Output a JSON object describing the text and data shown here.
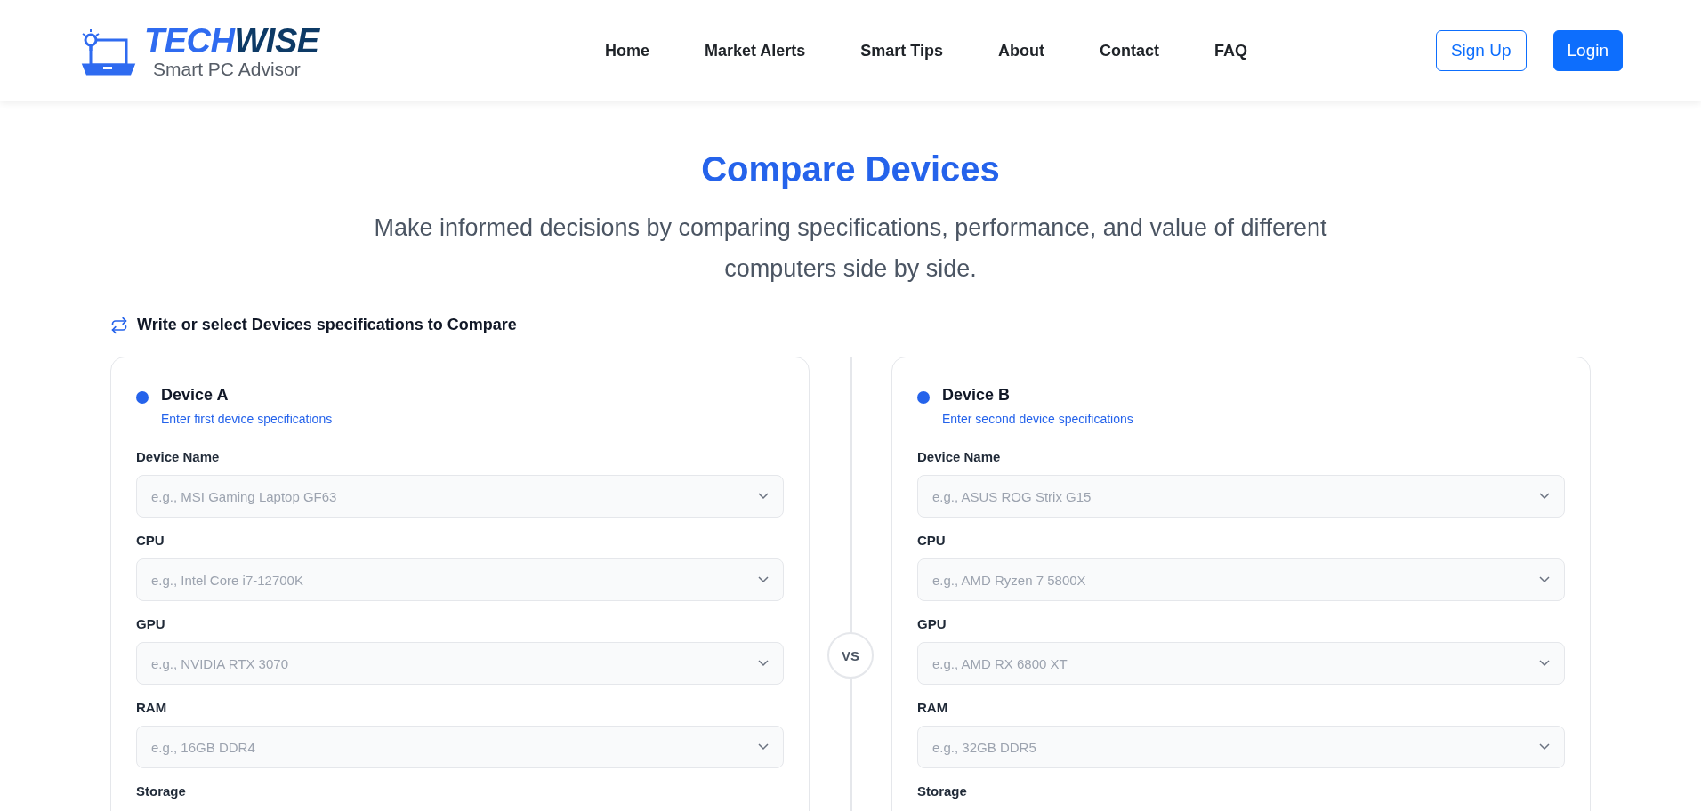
{
  "brand": {
    "name_part_1": "TECH",
    "name_part_2": "WISE",
    "tagline": "Smart PC Advisor"
  },
  "nav": [
    {
      "label": "Home"
    },
    {
      "label": "Market Alerts"
    },
    {
      "label": "Smart Tips"
    },
    {
      "label": "About"
    },
    {
      "label": "Contact"
    },
    {
      "label": "FAQ"
    }
  ],
  "auth": {
    "sign_up": "Sign Up",
    "login": "Login"
  },
  "page": {
    "title": "Compare Devices",
    "subtitle": "Make informed decisions by comparing specifications, performance, and value of different computers side by side."
  },
  "section_label": "Write or select Devices specifications to Compare",
  "divider_label": "VS",
  "devices": [
    {
      "title": "Device A",
      "subtitle": "Enter first device specifications",
      "fields": [
        {
          "label": "Device Name",
          "placeholder": "e.g., MSI Gaming Laptop GF63"
        },
        {
          "label": "CPU",
          "placeholder": "e.g., Intel Core i7-12700K"
        },
        {
          "label": "GPU",
          "placeholder": "e.g., NVIDIA RTX 3070"
        },
        {
          "label": "RAM",
          "placeholder": "e.g., 16GB DDR4"
        },
        {
          "label": "Storage"
        }
      ]
    },
    {
      "title": "Device B",
      "subtitle": "Enter second device specifications",
      "fields": [
        {
          "label": "Device Name",
          "placeholder": "e.g., ASUS ROG Strix G15"
        },
        {
          "label": "CPU",
          "placeholder": "e.g., AMD Ryzen 7 5800X"
        },
        {
          "label": "GPU",
          "placeholder": "e.g., AMD RX 6800 XT"
        },
        {
          "label": "RAM",
          "placeholder": "e.g., 32GB DDR5"
        },
        {
          "label": "Storage"
        }
      ]
    }
  ]
}
